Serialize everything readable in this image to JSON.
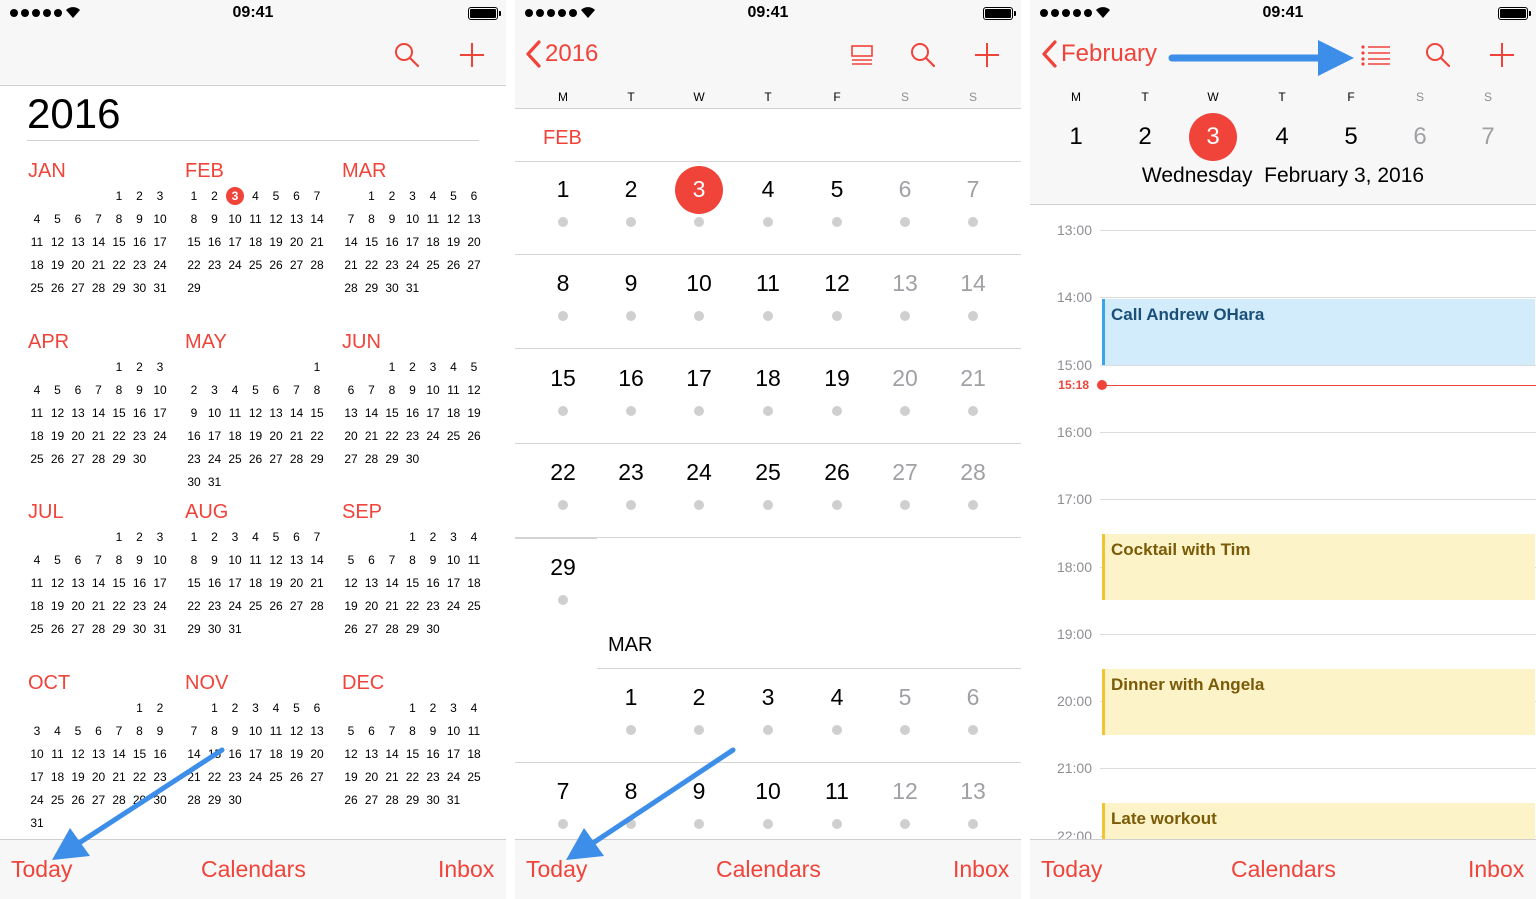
{
  "status": {
    "time": "09:41",
    "signal_icon": "signal-dots-icon",
    "wifi_icon": "wifi-icon",
    "battery_icon": "battery-icon"
  },
  "tabs": {
    "today": "Today",
    "calendars": "Calendars",
    "inbox": "Inbox"
  },
  "colors": {
    "accent": "#f0433a",
    "arrow": "#3d8ee8",
    "event_blue": "#d2ecfb",
    "event_yellow": "#fcf3c8"
  },
  "year_view": {
    "year": "2016",
    "icons": [
      "search-icon",
      "add-icon"
    ],
    "months": [
      {
        "name": "JAN",
        "start": 4,
        "days": 31
      },
      {
        "name": "FEB",
        "start": 0,
        "days": 29,
        "today": 3
      },
      {
        "name": "MAR",
        "start": 1,
        "days": 31
      },
      {
        "name": "APR",
        "start": 4,
        "days": 30
      },
      {
        "name": "MAY",
        "start": 6,
        "days": 31
      },
      {
        "name": "JUN",
        "start": 2,
        "days": 30
      },
      {
        "name": "JUL",
        "start": 4,
        "days": 31
      },
      {
        "name": "AUG",
        "start": 0,
        "days": 31
      },
      {
        "name": "SEP",
        "start": 3,
        "days": 30
      },
      {
        "name": "OCT",
        "start": 5,
        "days": 31
      },
      {
        "name": "NOV",
        "start": 1,
        "days": 30
      },
      {
        "name": "DEC",
        "start": 3,
        "days": 31
      }
    ]
  },
  "month_view": {
    "back_label": "2016",
    "icons": [
      "list-view-icon",
      "search-icon",
      "add-icon"
    ],
    "weekdays": [
      "M",
      "T",
      "W",
      "T",
      "F",
      "S",
      "S"
    ],
    "feb_label": "FEB",
    "mar_label": "MAR",
    "feb_rows": [
      [
        "1",
        "2",
        "3",
        "4",
        "5",
        "6",
        "7"
      ],
      [
        "8",
        "9",
        "10",
        "11",
        "12",
        "13",
        "14"
      ],
      [
        "15",
        "16",
        "17",
        "18",
        "19",
        "20",
        "21"
      ],
      [
        "22",
        "23",
        "24",
        "25",
        "26",
        "27",
        "28"
      ],
      [
        "29"
      ]
    ],
    "mar_rows": [
      [
        "",
        "1",
        "2",
        "3",
        "4",
        "5",
        "6"
      ],
      [
        "7",
        "8",
        "9",
        "10",
        "11",
        "12",
        "13"
      ]
    ],
    "today": "3"
  },
  "day_view": {
    "back_label": "February",
    "icons": [
      "list-view-icon",
      "search-icon",
      "add-icon"
    ],
    "weekdays": [
      "M",
      "T",
      "W",
      "T",
      "F",
      "S",
      "S"
    ],
    "week_days": [
      "1",
      "2",
      "3",
      "4",
      "5",
      "6",
      "7"
    ],
    "today": "3",
    "date_weekday": "Wednesday",
    "date_full": "February 3, 2016",
    "hours": [
      "13:00",
      "14:00",
      "15:00",
      "16:00",
      "17:00",
      "18:00",
      "19:00",
      "20:00",
      "21:00",
      "22:00"
    ],
    "now": "15:18",
    "events": [
      {
        "title": "Call Andrew OHara",
        "color": "blue",
        "start": 13.5,
        "end": 14.5
      },
      {
        "title": "Cocktail with Tim",
        "color": "yellow",
        "start": 17.0,
        "end": 18.0
      },
      {
        "title": "Dinner with Angela",
        "color": "yellow",
        "start": 19.0,
        "end": 20.0
      },
      {
        "title": "Late workout",
        "color": "yellow",
        "start": 21.0,
        "end": 22.0
      }
    ]
  }
}
